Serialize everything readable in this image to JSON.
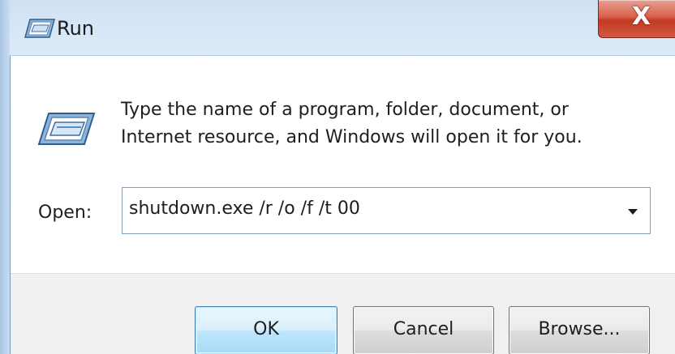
{
  "window": {
    "title": "Run",
    "close_glyph": "X"
  },
  "icons": {
    "title_icon": "run-icon",
    "big_icon": "run-icon",
    "close_icon": "close-icon",
    "dropdown_icon": "chevron-down-icon"
  },
  "body": {
    "description_line1": "Type the name of a program, folder, document, or",
    "description_line2": "Internet resource, and Windows will open it for you.",
    "open_label": "Open:",
    "open_value": "shutdown.exe /r /o /f /t 00"
  },
  "buttons": {
    "ok": "OK",
    "cancel": "Cancel",
    "browse": "Browse..."
  },
  "colors": {
    "titlebar": "#d6e6f6",
    "close_button": "#c23a22",
    "footer": "#f0f0f0",
    "ok_button_highlight": "#bee6fd"
  }
}
